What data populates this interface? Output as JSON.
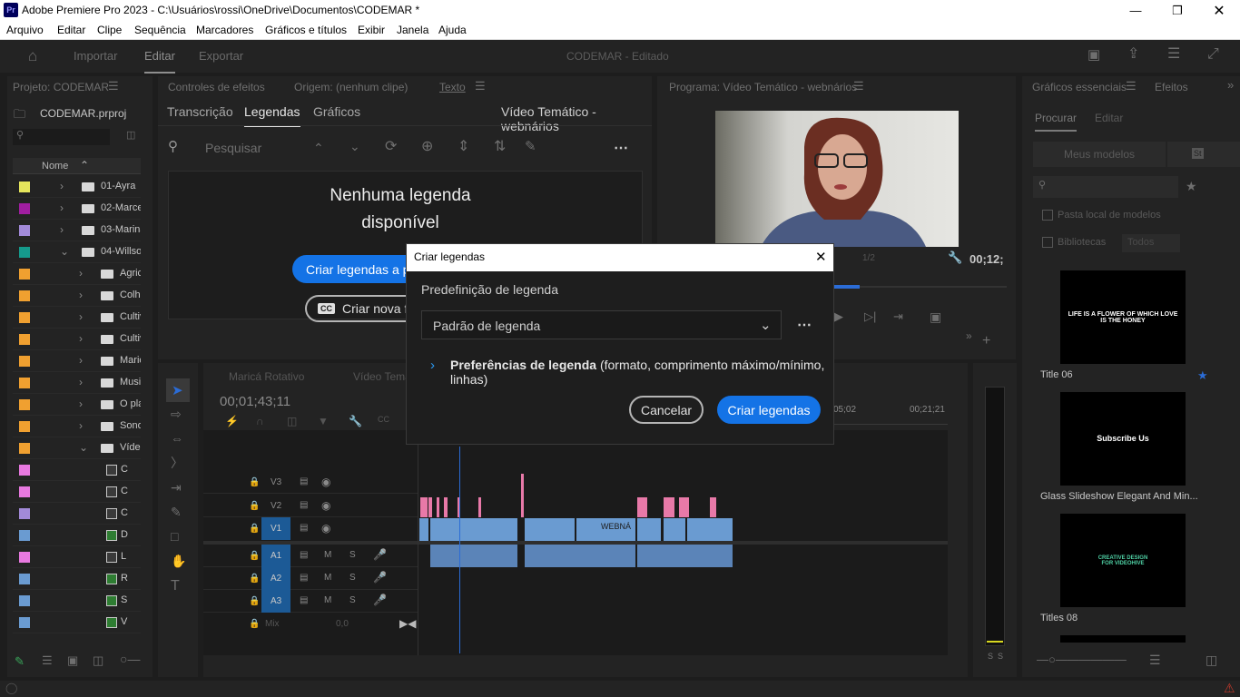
{
  "window": {
    "title": "Adobe Premiere Pro 2023 - C:\\Usuários\\rossi\\OneDrive\\Documentos\\CODEMAR *",
    "logo": "Pr"
  },
  "menu": [
    "Arquivo",
    "Editar",
    "Clipe",
    "Sequência",
    "Marcadores",
    "Gráficos e títulos",
    "Exibir",
    "Janela",
    "Ajuda"
  ],
  "workspace": {
    "tabs": [
      "Importar",
      "Editar",
      "Exportar"
    ],
    "doc_title": "CODEMAR - Editado"
  },
  "project": {
    "header": "Projeto: CODEMAR",
    "file": "CODEMAR.prproj",
    "col_name": "Nome",
    "items": [
      {
        "label": "01-Ayra",
        "color": "#e6e65c",
        "indent": 1,
        "type": "folder",
        "open": false
      },
      {
        "label": "02-Marce",
        "color": "#a01ea0",
        "indent": 1,
        "type": "folder",
        "open": false
      },
      {
        "label": "03-Marina",
        "color": "#a28ad8",
        "indent": 1,
        "type": "folder",
        "open": false
      },
      {
        "label": "04-Willso",
        "color": "#159a8c",
        "indent": 1,
        "type": "folder",
        "open": true
      },
      {
        "label": "Agric",
        "color": "#f0a030",
        "indent": 2,
        "type": "folder",
        "open": false
      },
      {
        "label": "Colhe",
        "color": "#f0a030",
        "indent": 2,
        "type": "folder",
        "open": false
      },
      {
        "label": "Cultiv",
        "color": "#f0a030",
        "indent": 2,
        "type": "folder",
        "open": false
      },
      {
        "label": "Cultiv",
        "color": "#f0a030",
        "indent": 2,
        "type": "folder",
        "open": false
      },
      {
        "label": "Maric",
        "color": "#f0a030",
        "indent": 2,
        "type": "folder",
        "open": false
      },
      {
        "label": "Music",
        "color": "#f0a030",
        "indent": 2,
        "type": "folder",
        "open": false
      },
      {
        "label": "O pla",
        "color": "#f0a030",
        "indent": 2,
        "type": "folder",
        "open": false
      },
      {
        "label": "Sonor",
        "color": "#f0a030",
        "indent": 2,
        "type": "folder",
        "open": false
      },
      {
        "label": "Vídeo",
        "color": "#f0a030",
        "indent": 2,
        "type": "folder",
        "open": true
      },
      {
        "label": "C",
        "color": "#e879e0",
        "indent": 3,
        "type": "file"
      },
      {
        "label": "C",
        "color": "#e879e0",
        "indent": 3,
        "type": "file"
      },
      {
        "label": "C",
        "color": "#a28ad8",
        "indent": 3,
        "type": "file"
      },
      {
        "label": "D",
        "color": "#6a9bd1",
        "indent": 3,
        "type": "seq"
      },
      {
        "label": "L",
        "color": "#e879e0",
        "indent": 3,
        "type": "file"
      },
      {
        "label": "R",
        "color": "#6a9bd1",
        "indent": 3,
        "type": "seq"
      },
      {
        "label": "S",
        "color": "#6a9bd1",
        "indent": 3,
        "type": "seq"
      },
      {
        "label": "V",
        "color": "#6a9bd1",
        "indent": 3,
        "type": "seq"
      }
    ]
  },
  "source_tabs": [
    "Controles de efeitos",
    "Origem: (nenhum clipe)",
    "Texto"
  ],
  "text_panel": {
    "subtabs": [
      "Transcrição",
      "Legendas",
      "Gráficos"
    ],
    "sequence_name": "Vídeo Temático - webnários",
    "search_placeholder": "Pesquisar",
    "empty_msg_1": "Nenhuma legenda",
    "empty_msg_2": "disponível",
    "create_btn": "Criar legendas a pa",
    "new_track_btn": "Criar nova fa"
  },
  "program": {
    "header": "Programa: Vídeo Temático - webnários",
    "timecode": "00;12;",
    "zoom": "1/2"
  },
  "essential": {
    "tabs": [
      "Gráficos essenciais",
      "Efeitos"
    ],
    "subtabs": [
      "Procurar",
      "Editar"
    ],
    "my_templates": "Meus modelos",
    "local_folder": "Pasta local de modelos",
    "libraries": "Bibliotecas",
    "all": "Todos",
    "templates": [
      {
        "title": "Title 06",
        "thumb": "LIFE IS A FLOWER OF WHICH LOVE IS THE HONEY"
      },
      {
        "title": "Glass Slideshow Elegant And Min...",
        "thumb": "Subscribe Us"
      },
      {
        "title": "Titles 08",
        "thumb": "CREATIVE DESIGN FOR VIDEOHIVE"
      }
    ]
  },
  "timeline": {
    "tabs": [
      "Maricá Rotativo",
      "Vídeo Temá"
    ],
    "timecode": "00;01;43;11",
    "ruler": [
      "05;02",
      "00;21;21"
    ],
    "tracks": [
      "V3",
      "V2",
      "V1",
      "A1",
      "A2",
      "A3"
    ],
    "mix_label": "Mix",
    "mix_value": "0,0",
    "clip_label": "WEBNÁ",
    "m_label": "M",
    "s_label": "S"
  },
  "dialog": {
    "title": "Criar legendas",
    "preset_label": "Predefinição de legenda",
    "preset_value": "Padrão de legenda",
    "prefs_bold": "Preferências de legenda",
    "prefs_rest": " (formato, comprimento máximo/mínimo, linhas)",
    "cancel": "Cancelar",
    "create": "Criar legendas"
  },
  "meter": {
    "s1": "S",
    "s2": "S"
  }
}
